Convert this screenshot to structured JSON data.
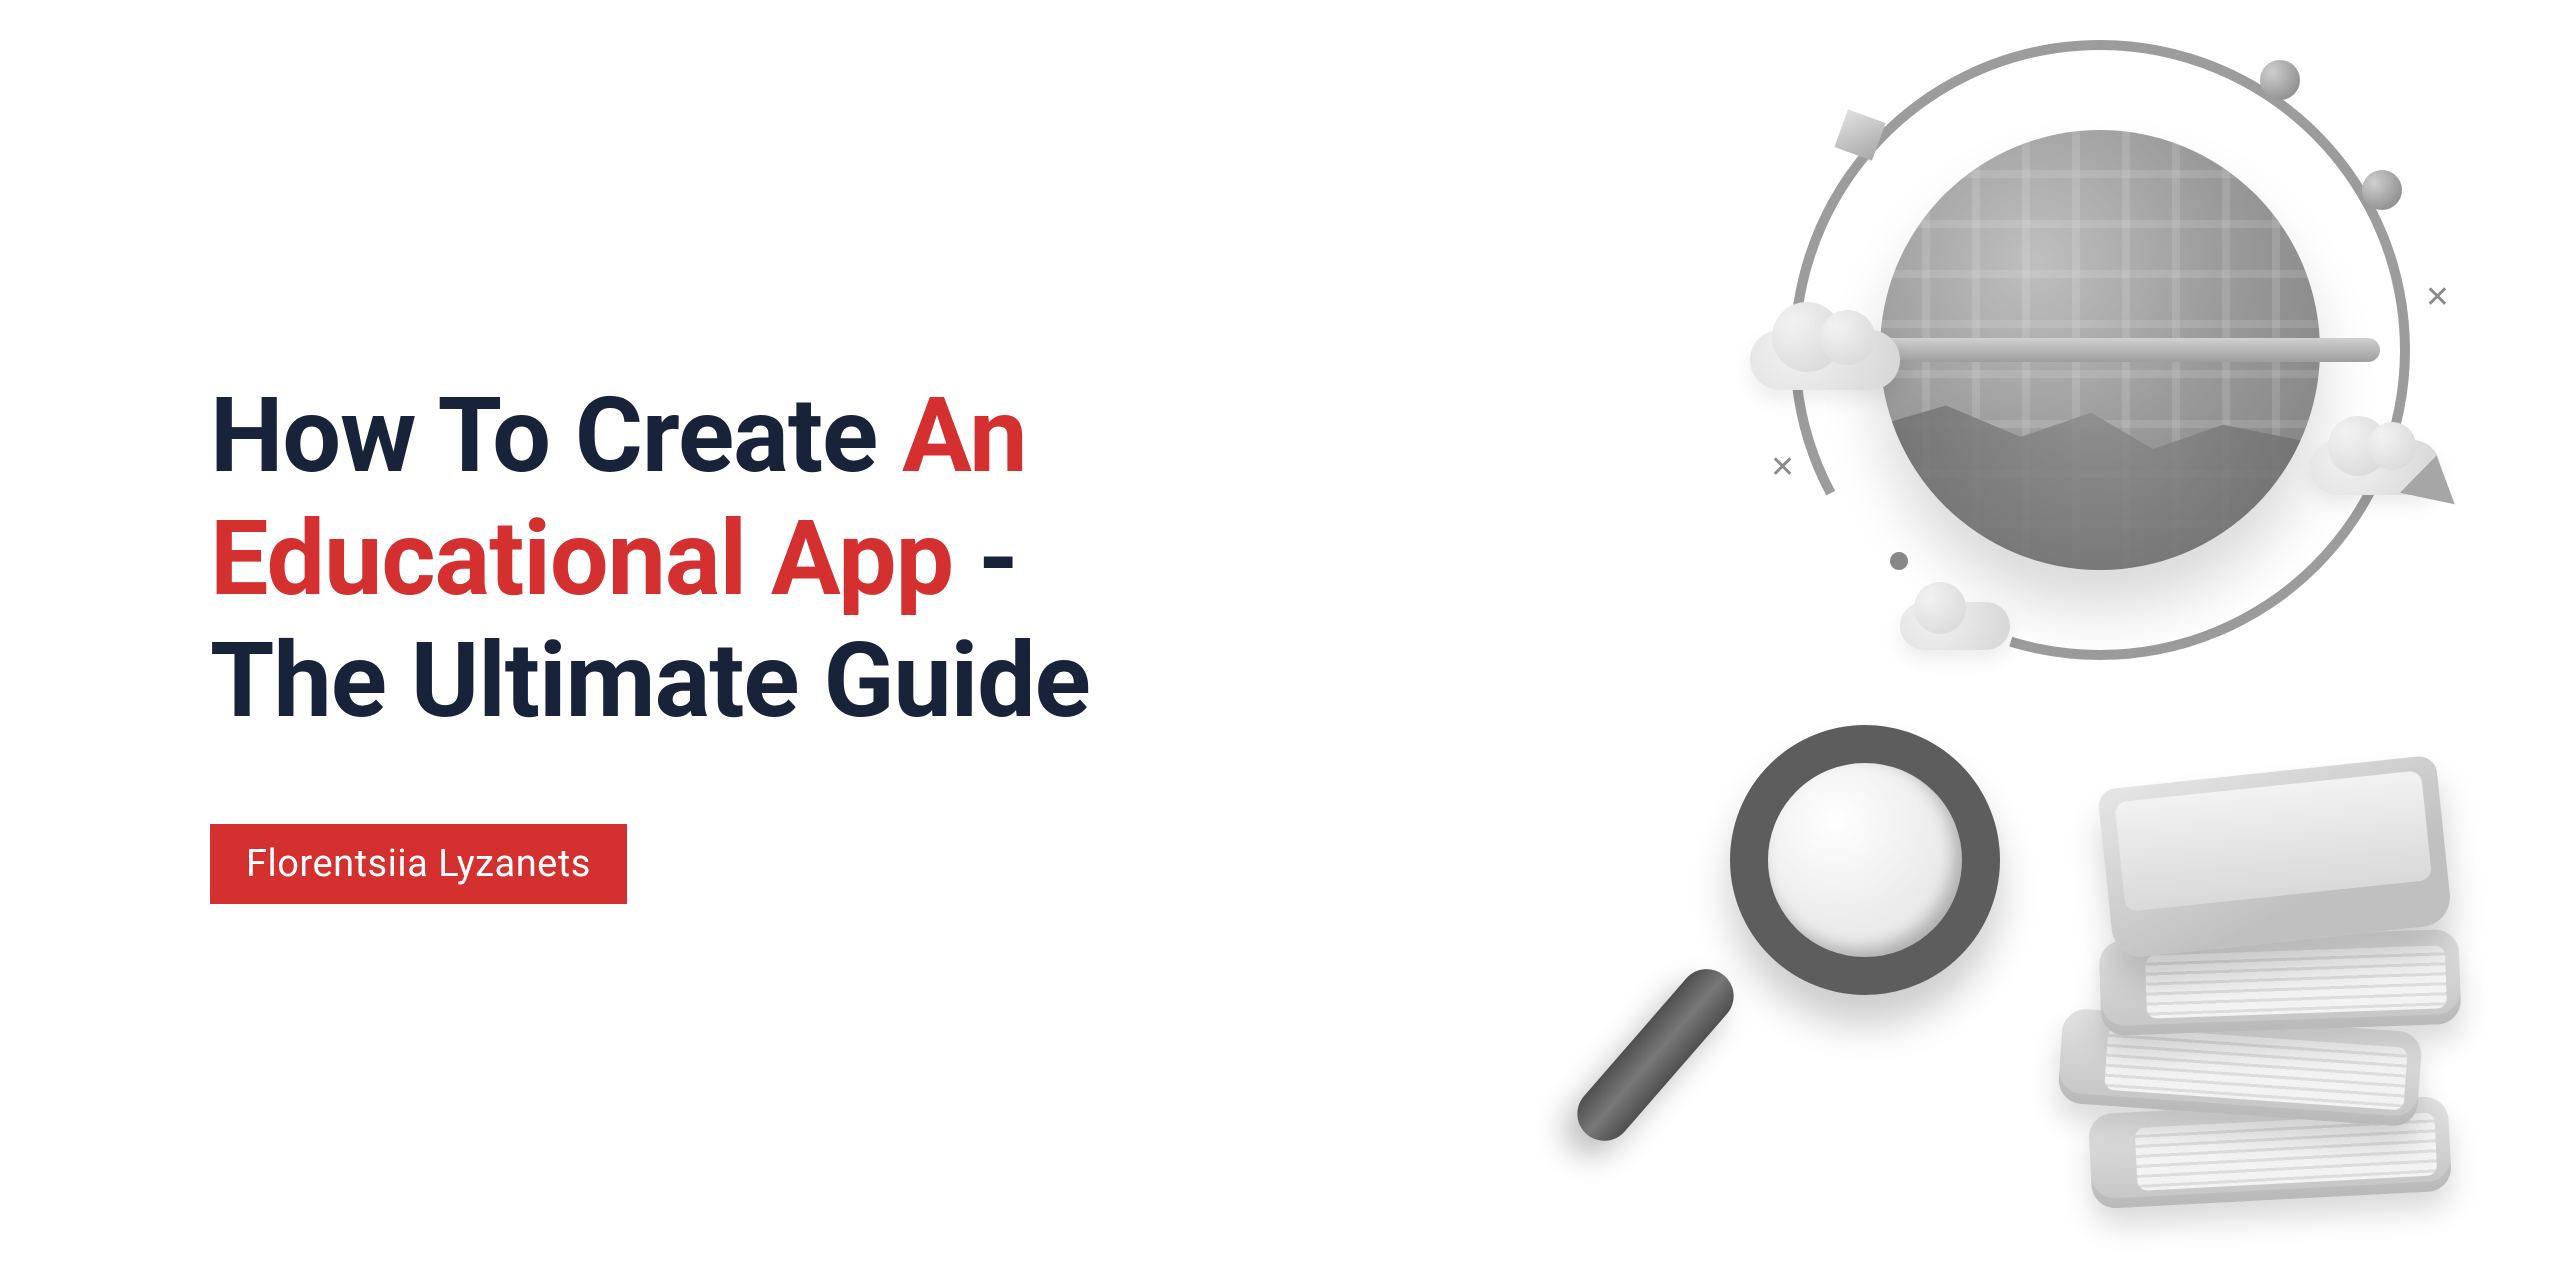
{
  "heading": {
    "part1_prefix": "How To Create ",
    "part1_accent": "An",
    "part2_accent": "Educational App",
    "part2_suffix": " -",
    "part3": "The Ultimate Guide"
  },
  "author": "Florentsiia Lyzanets",
  "colors": {
    "accent": "#d3302f",
    "heading_dark": "#18233a",
    "background": "#ffffff"
  },
  "illustration": {
    "globe": "globe-icon",
    "magnifier": "magnifier-icon",
    "books": "books-icon"
  }
}
